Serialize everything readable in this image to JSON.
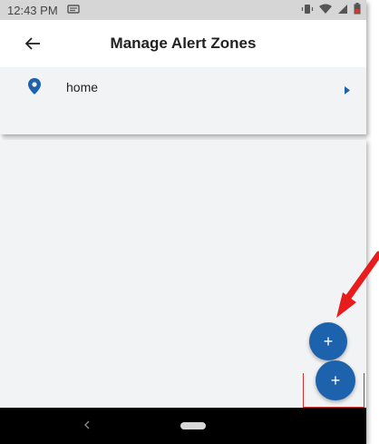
{
  "status_bar": {
    "time": "12:43 PM",
    "icons": [
      "notification-icon",
      "vibrate-icon",
      "wifi-icon",
      "signal-icon",
      "battery-icon"
    ],
    "battery_color": "#d23a2a"
  },
  "app_bar": {
    "title": "Manage Alert Zones",
    "back_icon": "arrow-left-icon"
  },
  "zones": [
    {
      "label": "home",
      "icon": "location-pin-icon",
      "trailing_icon": "chevron-right-icon"
    }
  ],
  "fab": {
    "label": "+"
  },
  "colors": {
    "accent": "#1c62ad",
    "list_background": "#f2f3f5",
    "status_bar": "#d6d6d6",
    "annotation": "#e81c1c"
  }
}
